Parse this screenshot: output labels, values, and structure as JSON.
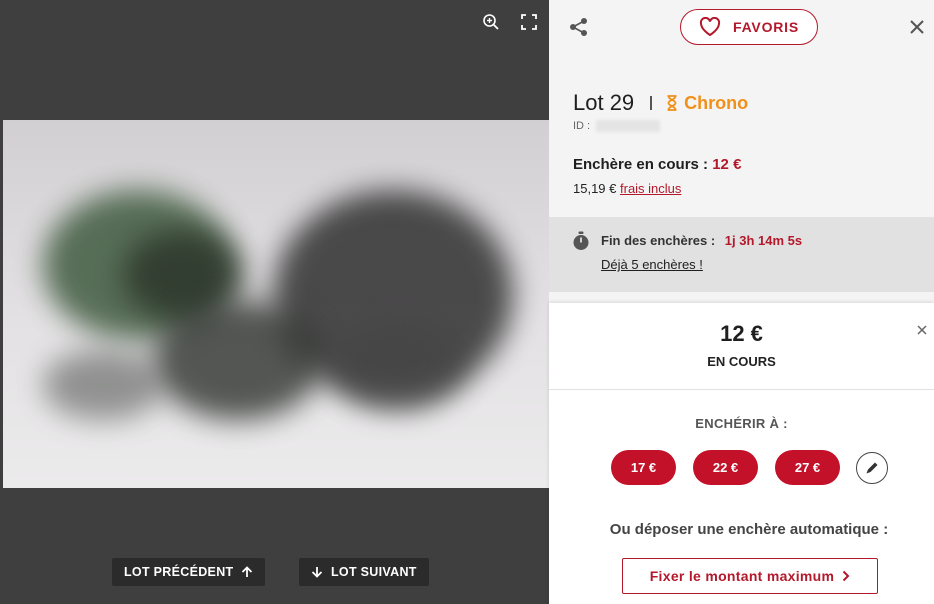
{
  "viewer": {
    "tools": [
      {
        "icon": "zoom-in-icon"
      },
      {
        "icon": "fullscreen-icon"
      }
    ],
    "prev_label": "LOT PRÉCÉDENT",
    "next_label": "LOT SUIVANT"
  },
  "header": {
    "favorites_label": "FAVORIS"
  },
  "lot": {
    "title": "Lot 29",
    "type_label": "Chrono",
    "id_label": "ID :"
  },
  "bid": {
    "current_label": "Enchère en cours :",
    "current_amount": "12 €",
    "incl_fees_amount": "15,19 €",
    "incl_fees_link": "frais inclus"
  },
  "end": {
    "label": "Fin des enchères :",
    "remaining": "1j 3h 14m 5s",
    "bids_count_link": "Déjà 5 enchères !"
  },
  "card": {
    "price": "12 €",
    "status": "EN COURS",
    "bid_at_label": "ENCHÉRIR À :",
    "quick_bids": [
      "17 €",
      "22 €",
      "27 €"
    ],
    "auto_bid_title": "Ou déposer une enchère automatique :",
    "max_button_label": "Fixer le montant maximum"
  },
  "colors": {
    "accent": "#b3192b",
    "button_red": "#c21128",
    "chrono_orange": "#f0901b"
  }
}
